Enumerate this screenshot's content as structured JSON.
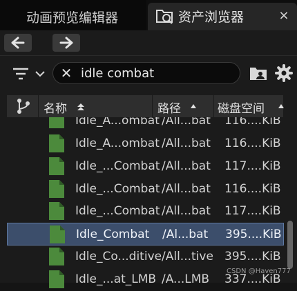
{
  "tabs": {
    "inactive_label": "动画预览编辑器",
    "active_label": "资产浏览器",
    "close_glyph": "×"
  },
  "search": {
    "value": "idle combat",
    "clear_glyph": "✕"
  },
  "columns": [
    {
      "label": "名称"
    },
    {
      "label": "路径"
    },
    {
      "label": "磁盘空间"
    }
  ],
  "rows": [
    {
      "name": "Idle_A...ombat",
      "path": "/All...bat",
      "size": "116....KiB",
      "selected": false
    },
    {
      "name": "Idle_A...ombat",
      "path": "/All...bat",
      "size": "116....KiB",
      "selected": false
    },
    {
      "name": "Idle_...Combat",
      "path": "/All...bat",
      "size": "117....KiB",
      "selected": false
    },
    {
      "name": "Idle_...Combat",
      "path": "/All...bat",
      "size": "116....KiB",
      "selected": false
    },
    {
      "name": "Idle_...Combat",
      "path": "/All...bat",
      "size": "117....KiB",
      "selected": false
    },
    {
      "name": "Idle_Combat",
      "path": "/Al...bat",
      "size": "395....KiB",
      "selected": true
    },
    {
      "name": "Idle_Co...ditive",
      "path": "/All...tive",
      "size": "395....KiB",
      "selected": false
    },
    {
      "name": "Idle_...at_LMB",
      "path": "/A...LMB",
      "size": "337....KiB",
      "selected": false
    }
  ],
  "watermark": "CSDN @Haven777",
  "colors": {
    "asset_icon": "#4c8a3c",
    "selected_row": "#3c4e6b"
  },
  "icons": [
    "animation-editor-icon",
    "asset-browser-icon",
    "back-arrow-icon",
    "forward-arrow-icon",
    "filter-icon",
    "chevron-down-icon",
    "folder-user-icon",
    "gear-icon",
    "branch-icon",
    "sort-ascending-icon",
    "animation-asset-icon"
  ]
}
